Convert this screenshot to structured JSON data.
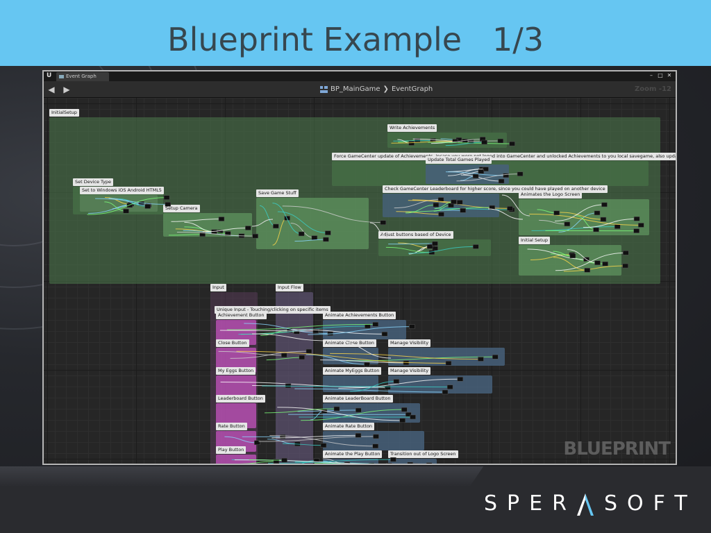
{
  "slide": {
    "title": "Blueprint Example   1/3",
    "logo_text": "SPERASOFT"
  },
  "editor": {
    "tab_label": "Event Graph",
    "breadcrumb_blueprint": "BP_MainGame",
    "breadcrumb_graph": "EventGraph",
    "zoom": "Zoom -12",
    "watermark": "BLUEPRINT",
    "minimize": "–",
    "maximize": "□",
    "close": "✕"
  },
  "comments": [
    {
      "label": "InitialSetup"
    },
    {
      "label": "Write Achievements"
    },
    {
      "label": "Force GameCenter update of Achievements, incase you were not loged into GameCenter and unlocked Achievements to you local savegame, also updates local data"
    },
    {
      "label": "Update Total Games Played"
    },
    {
      "label": "Set Device Type"
    },
    {
      "label": "Set to Windows iOS Android HTML5"
    },
    {
      "label": "Save Game Stuff"
    },
    {
      "label": "Check GameCenter Leaderboard for higher score, since you could have played on another device"
    },
    {
      "label": "Animates the Logo Screen"
    },
    {
      "label": "Setup Camera"
    },
    {
      "label": "Adjust buttons based of Device"
    },
    {
      "label": "Initial Setup"
    },
    {
      "label": "Input"
    },
    {
      "label": "Input Flow"
    },
    {
      "label": "Unique Input - Touching/clicking on specific items"
    },
    {
      "label": "Achievement Button"
    },
    {
      "label": "Animate Achievements Button"
    },
    {
      "label": "Close Button"
    },
    {
      "label": "Animate Close Button"
    },
    {
      "label": "Manage Visibility"
    },
    {
      "label": "My Eggs Button"
    },
    {
      "label": "Animate MyEggs Button"
    },
    {
      "label": "Manage Visibility"
    },
    {
      "label": "Leaderboard Button"
    },
    {
      "label": "Animate LeaderBoard Button"
    },
    {
      "label": "Rate Button"
    },
    {
      "label": "Animate Rate Button"
    },
    {
      "label": "Play Button"
    },
    {
      "label": "Animate the Play Button"
    },
    {
      "label": "Transition out of Logo Screen"
    }
  ],
  "colors": {
    "header": "#66c6f2",
    "title": "#37474f",
    "comment_green": "#4d7a4d",
    "comment_blue": "#46607a",
    "comment_pink": "#b54fb0",
    "comment_lavender": "#6e5f87"
  }
}
